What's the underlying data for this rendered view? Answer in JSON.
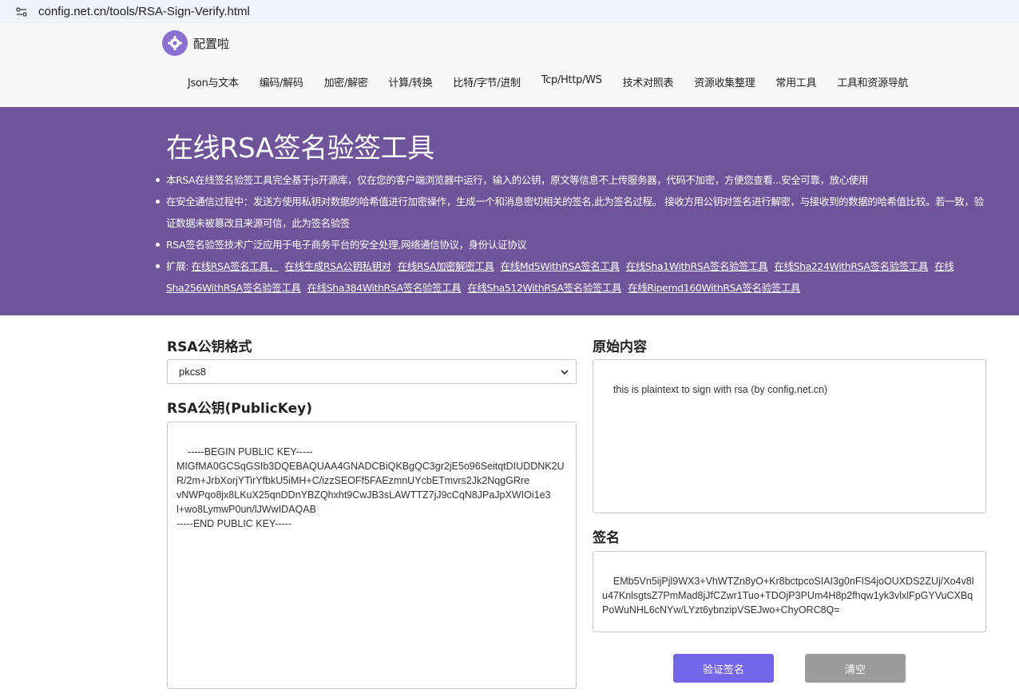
{
  "browser": {
    "url": "config.net.cn/tools/RSA-Sign-Verify.html"
  },
  "header": {
    "logo_text": "配置啦",
    "nav": [
      "Json与文本",
      "编码/解码",
      "加密/解密",
      "计算/转换",
      "比特/字节/进制",
      "Tcp/Http/WS",
      "技术对照表",
      "资源收集整理",
      "常用工具",
      "工具和资源导航"
    ]
  },
  "banner": {
    "title": "在线RSA签名验签工具",
    "bullet1": "本RSA在线签名验签工具完全基于js开源库，仅在您的客户端浏览器中运行，输入的公钥，原文等信息不上传服务器，代码不加密，方便您查看...安全可靠，放心使用",
    "bullet2": "在安全通信过程中：发送方使用私钥对数据的哈希值进行加密操作，生成一个和消息密切相关的签名,此为签名过程。 接收方用公钥对签名进行解密，与接收到的数据的哈希值比较。若一致，验证数据未被篡改且来源可信，此为签名验签",
    "bullet3": "RSA签名验签技术广泛应用于电子商务平台的安全处理,网络通信协议，身份认证协议",
    "extend_label": "扩展: ",
    "links": [
      "在线RSA签名工具，",
      "在线生成RSA公钥私钥对",
      "在线RSA加密解密工具",
      "在线Md5WithRSA签名工具",
      "在线Sha1WithRSA签名验签工具",
      "在线Sha224WithRSA签名验签工具",
      "在线Sha256WithRSA签名验签工具",
      "在线Sha384WithRSA签名验签工具",
      "在线Sha512WithRSA签名验签工具",
      "在线Ripemd160WithRSA签名验签工具"
    ]
  },
  "form": {
    "format_label": "RSA公钥格式",
    "format_value": "pkcs8",
    "pubkey_label": "RSA公钥(PublicKey)",
    "pubkey_value": "-----BEGIN PUBLIC KEY-----\nMIGfMA0GCSqGSIb3DQEBAQUAA4GNADCBiQKBgQC3gr2jE5o96SeitqtDIUDDNK2U\nR/2m+JrbXorjYTirYfbkU5iMH+C/izzSEOFf5FAEzmnUYcbETmvrs2Jk2NqgGRre\nvNWPqo8jx8LKuX25qnDDnYBZQhxht9CwJB3sLAWTTZ7jJ9cCqN8JPaJpXWIOi1e3\nl+wo8LymwP0un/lJWwIDAQAB\n-----END PUBLIC KEY-----",
    "plaintext_label": "原始内容",
    "plaintext_value": "this is plaintext to sign with rsa (by config.net.cn)",
    "signature_label": "签名",
    "signature_value": "EMb5Vn5ijPjl9WX3+VhWTZn8yO+Kr8bctpcoSIAI3g0nFIS4joOUXDS2ZUj/Xo4v8lu47KnlsgtsZ7PmMad8jJfCZwr1Tuo+TDOjP3PUm4H8p2fhqw1yk3vlxlFpGYVuCXBqPoWuNHL6cNYw/LYzt6ybnzipVSEJwo+ChyORC8Q=",
    "verify_button": "验证签名",
    "clear_button": "清空"
  },
  "colors": {
    "banner_bg": "#6f5499",
    "verify_button": "#7466e8",
    "clear_button": "#9b9b9b",
    "logo": "#8b6fd1"
  }
}
